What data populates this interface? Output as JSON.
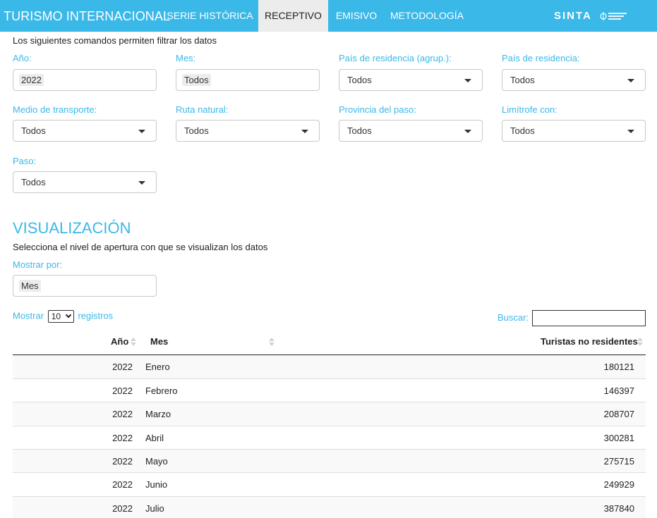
{
  "navbar": {
    "brand": "TURISMO INTERNACIONAL",
    "tabs": [
      {
        "label": "SERIE HISTÓRICA"
      },
      {
        "label": "RECEPTIVO"
      },
      {
        "label": "EMISIVO"
      },
      {
        "label": "METODOLOGÍA"
      }
    ],
    "active_tab": "RECEPTIVO",
    "logo_text": "SINTA",
    "gov_logo_name": "argentina-gov-logo",
    "accent_color": "#3ab8e8"
  },
  "filters": {
    "intro": "Los siguientes comandos permiten filtrar los datos",
    "year": {
      "label": "Año:",
      "value": "2022"
    },
    "month": {
      "label": "Mes:",
      "value": "Todos"
    },
    "residence_group": {
      "label": "País de residencia (agrup.):",
      "value": "Todos"
    },
    "residence_country": {
      "label": "País de residencia:",
      "value": "Todos"
    },
    "transport": {
      "label": "Medio de transporte:",
      "value": "Todos"
    },
    "route": {
      "label": "Ruta natural:",
      "value": "Todos"
    },
    "province": {
      "label": "Provincia del paso:",
      "value": "Todos"
    },
    "border": {
      "label": "Limítrofe con:",
      "value": "Todos"
    },
    "pass": {
      "label": "Paso:",
      "value": "Todos"
    }
  },
  "visualization": {
    "title": "VISUALIZACIÓN",
    "subtitle": "Selecciona el nivel de apertura con que se visualizan los datos",
    "show_by": {
      "label": "Mostrar por:",
      "value": "Mes"
    }
  },
  "table": {
    "length_prefix": "Mostrar",
    "length_value": "10",
    "length_suffix": "registros",
    "search_label": "Buscar:",
    "headers": {
      "year": "Año",
      "month": "Mes",
      "tourists": "Turistas no residentes"
    },
    "rows": [
      {
        "year": "2022",
        "month": "Enero",
        "tourists": "180121"
      },
      {
        "year": "2022",
        "month": "Febrero",
        "tourists": "146397"
      },
      {
        "year": "2022",
        "month": "Marzo",
        "tourists": "208707"
      },
      {
        "year": "2022",
        "month": "Abril",
        "tourists": "300281"
      },
      {
        "year": "2022",
        "month": "Mayo",
        "tourists": "275715"
      },
      {
        "year": "2022",
        "month": "Junio",
        "tourists": "249929"
      },
      {
        "year": "2022",
        "month": "Julio",
        "tourists": "387840"
      }
    ]
  }
}
